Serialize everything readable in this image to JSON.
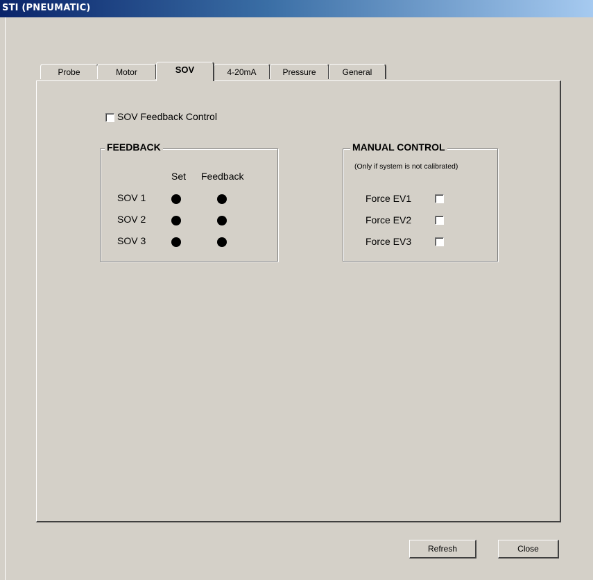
{
  "window": {
    "title": "STI (PNEUMATIC)"
  },
  "tabs": [
    {
      "label": "Probe"
    },
    {
      "label": "Motor"
    },
    {
      "label": "SOV"
    },
    {
      "label": "4-20mA"
    },
    {
      "label": "Pressure"
    },
    {
      "label": "General"
    }
  ],
  "active_tab": "SOV",
  "sov": {
    "feedback_control_label": "SOV Feedback Control",
    "feedback": {
      "title": "FEEDBACK",
      "col_set": "Set",
      "col_feedback": "Feedback",
      "rows": [
        {
          "label": "SOV 1"
        },
        {
          "label": "SOV 2"
        },
        {
          "label": "SOV 3"
        }
      ]
    },
    "manual": {
      "title": "MANUAL CONTROL",
      "note": "(Only if system is not calibrated)",
      "items": [
        {
          "label": "Force EV1"
        },
        {
          "label": "Force EV2"
        },
        {
          "label": "Force EV3"
        }
      ]
    }
  },
  "buttons": {
    "refresh": "Refresh",
    "close": "Close"
  },
  "colors": {
    "face": "#d4d0c8",
    "titlebar_start": "#0a246a",
    "titlebar_end": "#a6caf0",
    "indicator": "#000000"
  }
}
